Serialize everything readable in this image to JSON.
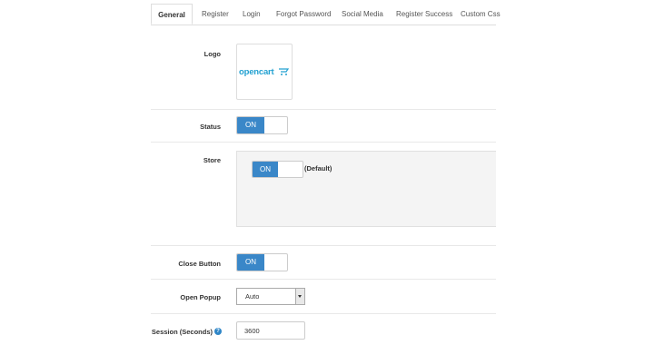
{
  "tabs": [
    {
      "label": "General",
      "active": true
    },
    {
      "label": "Register"
    },
    {
      "label": "Login"
    },
    {
      "label": "Forgot Password"
    },
    {
      "label": "Social Media"
    },
    {
      "label": "Register Success"
    },
    {
      "label": "Custom Css"
    }
  ],
  "form": {
    "logo": {
      "label": "Logo",
      "logo_text": "opencart"
    },
    "status": {
      "label": "Status",
      "toggle": "ON"
    },
    "store": {
      "label": "Store",
      "toggle": "ON",
      "option_label": "(Default)"
    },
    "close_button": {
      "label": "Close Button",
      "toggle": "ON"
    },
    "open_popup": {
      "label": "Open Popup",
      "value": "Auto"
    },
    "session": {
      "label": "Session (Seconds)",
      "value": "3600",
      "help_icon": "question-circle-icon"
    }
  },
  "colors": {
    "accent": "#3a87c8",
    "logo": "#23a1d1",
    "border": "#dddddd",
    "panel": "#f4f4f4"
  }
}
